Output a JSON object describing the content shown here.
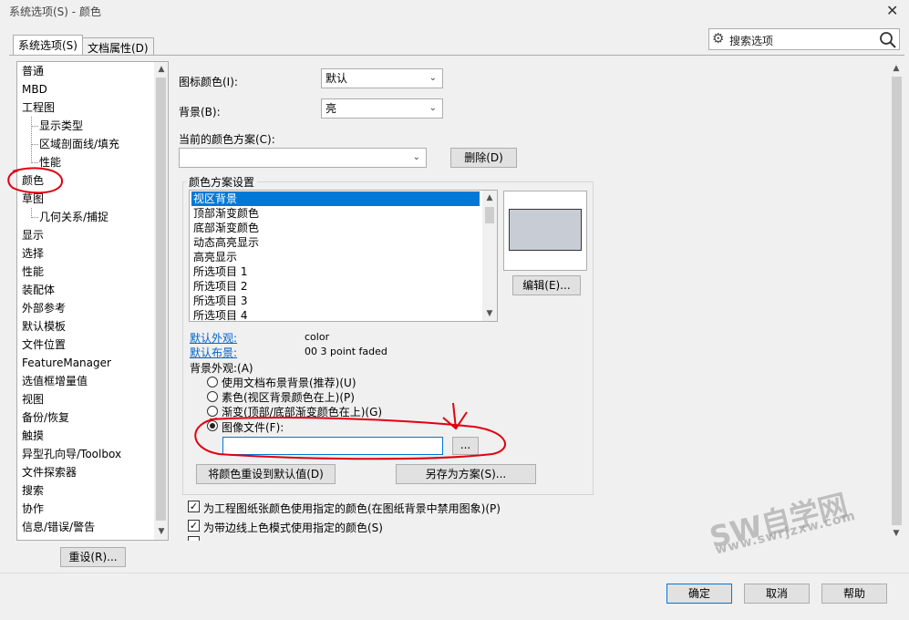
{
  "window": {
    "title": "系统选项(S) - 颜色"
  },
  "tabs": [
    {
      "label": "系统选项(S)",
      "active": true
    },
    {
      "label": "文档属性(D)",
      "active": false
    }
  ],
  "search": {
    "placeholder": "搜索选项"
  },
  "tree": {
    "items": [
      {
        "label": "普通",
        "level": 0
      },
      {
        "label": "MBD",
        "level": 0
      },
      {
        "label": "工程图",
        "level": 0
      },
      {
        "label": "显示类型",
        "level": 1
      },
      {
        "label": "区域剖面线/填充",
        "level": 1
      },
      {
        "label": "性能",
        "level": 1
      },
      {
        "label": "颜色",
        "level": 0,
        "selected": true
      },
      {
        "label": "草图",
        "level": 0
      },
      {
        "label": "几何关系/捕捉",
        "level": 1
      },
      {
        "label": "显示",
        "level": 0
      },
      {
        "label": "选择",
        "level": 0
      },
      {
        "label": "性能",
        "level": 0
      },
      {
        "label": "装配体",
        "level": 0
      },
      {
        "label": "外部参考",
        "level": 0
      },
      {
        "label": "默认模板",
        "level": 0
      },
      {
        "label": "文件位置",
        "level": 0
      },
      {
        "label": "FeatureManager",
        "level": 0
      },
      {
        "label": "选值框增量值",
        "level": 0
      },
      {
        "label": "视图",
        "level": 0
      },
      {
        "label": "备份/恢复",
        "level": 0
      },
      {
        "label": "触摸",
        "level": 0
      },
      {
        "label": "异型孔向导/Toolbox",
        "level": 0
      },
      {
        "label": "文件探索器",
        "level": 0
      },
      {
        "label": "搜索",
        "level": 0
      },
      {
        "label": "协作",
        "level": 0
      },
      {
        "label": "信息/错误/警告",
        "level": 0
      }
    ]
  },
  "reset_button": "重设(R)...",
  "icon_color": {
    "label": "图标颜色(I):",
    "value": "默认"
  },
  "background": {
    "label": "背景(B):",
    "value": "亮"
  },
  "scheme": {
    "label": "当前的颜色方案(C):",
    "value": "",
    "delete_button": "删除(D)"
  },
  "scheme_settings": {
    "title": "颜色方案设置",
    "items": [
      {
        "label": "视区背景",
        "selected": true
      },
      {
        "label": "顶部渐变颜色"
      },
      {
        "label": "底部渐变颜色"
      },
      {
        "label": "动态高亮显示"
      },
      {
        "label": "高亮显示"
      },
      {
        "label": "所选项目 1"
      },
      {
        "label": "所选项目 2"
      },
      {
        "label": "所选项目 3"
      },
      {
        "label": "所选项目 4"
      }
    ],
    "edit_button": "编辑(E)...",
    "preview_color": "#c8ccd4",
    "default_appearance": {
      "label": "默认外观:",
      "value": "color"
    },
    "default_scene": {
      "label": "默认布景:",
      "value": "00 3 point faded"
    },
    "bg_appearance_label": "背景外观:(A)",
    "radios": [
      {
        "label": "使用文档布景背景(推荐)(U)",
        "checked": false
      },
      {
        "label": "素色(视区背景颜色在上)(P)",
        "checked": false
      },
      {
        "label": "渐变(顶部/底部渐变颜色在上)(G)",
        "checked": false
      },
      {
        "label": "图像文件(F):",
        "checked": true
      }
    ],
    "image_path": "",
    "browse_button": "...",
    "reset_colors_button": "将颜色重设到默认值(D)",
    "save_scheme_button": "另存为方案(S)..."
  },
  "checkboxes": [
    {
      "label": "为工程图纸张颜色使用指定的颜色(在图纸背景中禁用图象)(P)",
      "checked": true
    },
    {
      "label": "为带边线上色模式使用指定的颜色(S)",
      "checked": true
    }
  ],
  "footer": {
    "ok": "确定",
    "cancel": "取消",
    "help": "帮助"
  },
  "watermark": {
    "main": "SW自学网",
    "sub": "www.swrjzxw.com"
  },
  "colors": {
    "selection": "#0078d7",
    "annotation": "#e00010",
    "link": "#0066cc"
  }
}
